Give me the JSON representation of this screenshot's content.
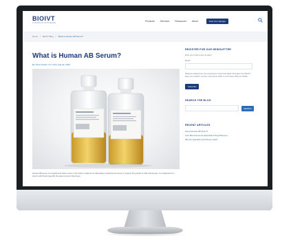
{
  "site": {
    "logo": "BIOIVT",
    "logo_tagline": "A PASSION IN SCIENCE",
    "nav": [
      "Products",
      "Services",
      "Resources",
      "About"
    ],
    "nav_cta": "Find Your Sample",
    "breadcrumb": [
      "Home",
      "BioIVT Blog",
      "What is Human AB Serum?"
    ]
  },
  "post": {
    "title": "What is Human AB Serum?",
    "meta": "By Trevor Austin | Fri, Feb | Aug 30, 2023",
    "body_preview": "Human AB serum is a supplement that is used in cell culture media as an alternative to fetal bovine serum to support the growth of cells and tissues. It is collected from donors with blood type AB, the least common blood type."
  },
  "sidebar": {
    "newsletter_heading": "REGISTER FOR OUR NEWSLETTER",
    "newsletter_intro": "Enter your email to sign up today!",
    "email_label": "Email*",
    "consent_text": "Please be advised you are consenting to receive the latest information from BioIVT about our products, services, and events. Refer to our Privacy Policy for details.",
    "subscribe_label": "Subscribe",
    "search_heading": "SEARCH THE BLOG",
    "search_button": "SEARCH",
    "recent_heading": "RECENT ARTICLES",
    "recent_articles": [
      "How is Human AB Serum?",
      "Liver Microsomes Are Essential In Drug Discovery",
      "Why Do Scientists Use Primary Cells?"
    ]
  },
  "colors": {
    "brand": "#1d3a7a",
    "link": "#2a6cb5"
  }
}
